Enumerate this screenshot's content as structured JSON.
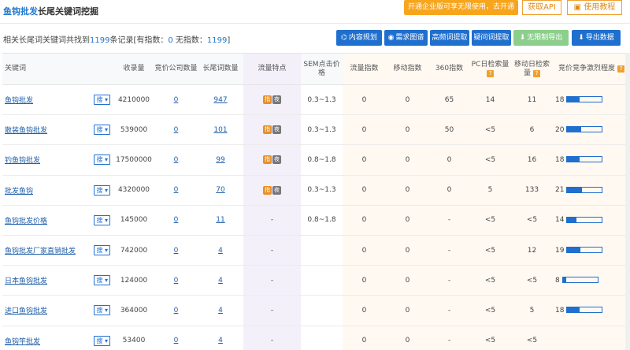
{
  "header": {
    "title_part1": "鱼钩批发",
    "title_part2": "长尾关键词挖掘",
    "promo": "开通企业版可享无限使用，去开通",
    "api": "获取API",
    "tutorial": "使用教程"
  },
  "summary": {
    "pre": "相关长尾词关键词共找到",
    "count": "1199",
    "mid": "条记录[有指数：",
    "with_index": "0",
    "mid2": " 无指数：",
    "no_index": "1199",
    "post": "]"
  },
  "tools": [
    "内容规划",
    "需求图谱",
    "高频词提取",
    "疑问词提取",
    "无限制导出",
    "导出数据"
  ],
  "columns": [
    "关键词",
    "收录量",
    "竞价公司数量",
    "长尾词数量",
    "流量特点",
    "SEM点击价格",
    "流量指数",
    "移动指数",
    "360指数",
    "PC日检索量",
    "移动日检索量",
    "竞价竞争激烈程度"
  ],
  "search_label": "搜",
  "tag_labels": [
    "指",
    "夜"
  ],
  "rows": [
    {
      "kw": "鱼钩批发",
      "sl": "4210000",
      "jj": "0",
      "cw": "947",
      "tag": true,
      "sem": "0.3~1.3",
      "ll": "0",
      "yd": "0",
      "s360": "65",
      "pc": "14",
      "mob": "11",
      "comp": "18",
      "pct": 0.35
    },
    {
      "kw": "散装鱼钩批发",
      "sl": "539000",
      "jj": "0",
      "cw": "101",
      "tag": true,
      "sem": "0.3~1.3",
      "ll": "0",
      "yd": "0",
      "s360": "50",
      "pc": "<5",
      "mob": "6",
      "comp": "20",
      "pct": 0.4
    },
    {
      "kw": "钓鱼钩批发",
      "sl": "17500000",
      "jj": "0",
      "cw": "99",
      "tag": true,
      "sem": "0.8~1.8",
      "ll": "0",
      "yd": "0",
      "s360": "0",
      "pc": "<5",
      "mob": "16",
      "comp": "18",
      "pct": 0.35
    },
    {
      "kw": "批发鱼钩",
      "sl": "4320000",
      "jj": "0",
      "cw": "70",
      "tag": true,
      "sem": "0.3~1.3",
      "ll": "0",
      "yd": "0",
      "s360": "0",
      "pc": "5",
      "mob": "133",
      "comp": "21",
      "pct": 0.42
    },
    {
      "kw": "鱼钩批发价格",
      "sl": "145000",
      "jj": "0",
      "cw": "11",
      "tag": false,
      "sem": "0.8~1.8",
      "ll": "0",
      "yd": "0",
      "s360": "-",
      "pc": "<5",
      "mob": "<5",
      "comp": "14",
      "pct": 0.27
    },
    {
      "kw": "鱼钩批发厂家直销批发",
      "sl": "742000",
      "jj": "0",
      "cw": "4",
      "tag": false,
      "sem": "",
      "ll": "0",
      "yd": "0",
      "s360": "-",
      "pc": "<5",
      "mob": "12",
      "comp": "19",
      "pct": 0.38
    },
    {
      "kw": "日本鱼钩批发",
      "sl": "124000",
      "jj": "0",
      "cw": "4",
      "tag": false,
      "sem": "",
      "ll": "0",
      "yd": "0",
      "s360": "-",
      "pc": "<5",
      "mob": "<5",
      "comp": "8",
      "pct": 0.1
    },
    {
      "kw": "进口鱼钩批发",
      "sl": "364000",
      "jj": "0",
      "cw": "4",
      "tag": false,
      "sem": "",
      "ll": "0",
      "yd": "0",
      "s360": "-",
      "pc": "<5",
      "mob": "5",
      "comp": "18",
      "pct": 0.35
    },
    {
      "kw": "鱼钩竿批发",
      "sl": "53400",
      "jj": "0",
      "cw": "4",
      "tag": false,
      "sem": "",
      "ll": "0",
      "yd": "0",
      "s360": "-",
      "pc": "<5",
      "mob": "<5",
      "comp": "",
      "pct": 0
    }
  ]
}
